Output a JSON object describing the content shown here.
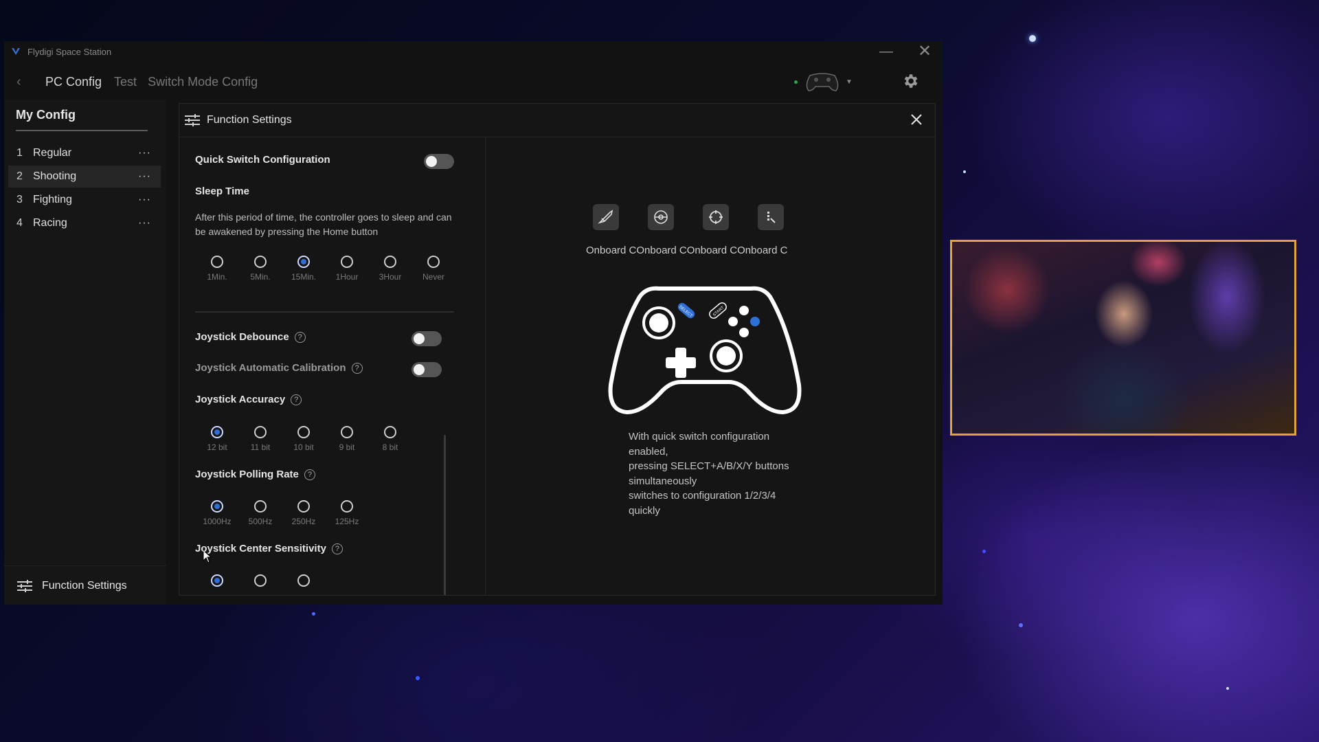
{
  "app": {
    "title": "Flydigi Space Station",
    "minimize_icon": "minimize-icon",
    "close_icon": "close-icon"
  },
  "nav": {
    "back_icon": "chevron-left-icon",
    "tabs": [
      {
        "label": "PC Config",
        "active": true
      },
      {
        "label": "Test",
        "active": false
      },
      {
        "label": "Switch Mode Config",
        "active": false
      }
    ],
    "controller_status_color": "#2aa84a"
  },
  "sidebar": {
    "title": "My Config",
    "items": [
      {
        "num": "1",
        "label": "Regular",
        "active": false
      },
      {
        "num": "2",
        "label": "Shooting",
        "active": true
      },
      {
        "num": "3",
        "label": "Fighting",
        "active": false
      },
      {
        "num": "4",
        "label": "Racing",
        "active": false
      }
    ],
    "more_glyph": "···",
    "footer_label": "Function Settings"
  },
  "panel": {
    "title": "Function Settings",
    "quick_switch": {
      "label": "Quick Switch Configuration",
      "enabled": false
    },
    "sleep_time": {
      "label": "Sleep Time",
      "description": "After this period of time, the controller goes to sleep and can be awakened by pressing the Home button",
      "options": [
        "1Min.",
        "5Min.",
        "15Min.",
        "1Hour",
        "3Hour",
        "Never"
      ],
      "selected": "15Min."
    },
    "joystick_debounce": {
      "label": "Joystick Debounce",
      "enabled": false
    },
    "joystick_auto_calibration": {
      "label": "Joystick Automatic Calibration",
      "enabled": false
    },
    "joystick_accuracy": {
      "label": "Joystick Accuracy",
      "options": [
        "12 bit",
        "11 bit",
        "10 bit",
        "9 bit",
        "8 bit"
      ],
      "selected": "12 bit"
    },
    "joystick_polling_rate": {
      "label": "Joystick Polling Rate",
      "options": [
        "1000Hz",
        "500Hz",
        "250Hz",
        "125Hz"
      ],
      "selected": "1000Hz"
    },
    "joystick_center_sensitivity": {
      "label": "Joystick Center Sensitivity",
      "options": [
        "",
        "",
        ""
      ],
      "selected_index": 0
    },
    "mode_icons": [
      "shooting-mode-icon",
      "racing-mode-icon",
      "crosshair-mode-icon",
      "custom-mode-icon"
    ],
    "mode_labels": "Onboard COnboard COnboard COnboard C",
    "controller_labels": {
      "select": "SELECT",
      "start": "START"
    },
    "info": [
      "With quick switch configuration",
      "enabled,",
      "pressing SELECT+A/B/X/Y buttons",
      "simultaneously",
      "switches to configuration 1/2/3/4",
      "quickly"
    ]
  },
  "colors": {
    "accent": "#2f6fd8",
    "webcam_border": "#e0a43a",
    "panel_bg": "#151515"
  }
}
